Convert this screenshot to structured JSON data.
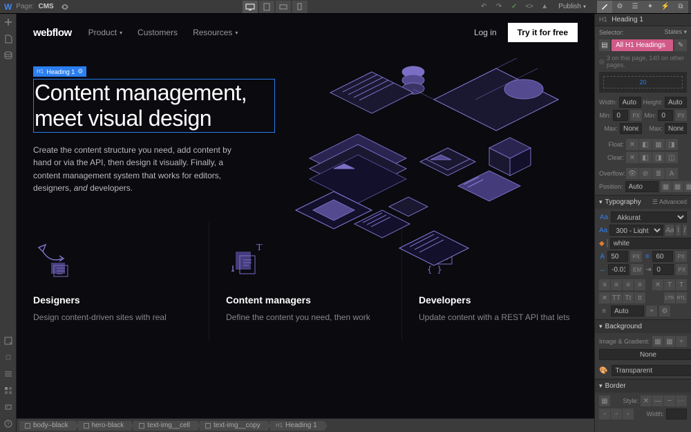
{
  "top_bar": {
    "page_label": "Page:",
    "page_name": "CMS",
    "publish": "Publish"
  },
  "site": {
    "logo": "webflow",
    "nav": {
      "product": "Product",
      "customers": "Customers",
      "resources": "Resources"
    },
    "login": "Log in",
    "cta": "Try it for free"
  },
  "selection_indicator": {
    "tag": "H1",
    "label": "Heading 1"
  },
  "hero": {
    "title": "Content management, meet visual design",
    "subtitle_1": "Create the content structure you need, add content by hand or via the API, then design it visually. Finally, a content management system that works for editors, designers, ",
    "subtitle_and": "and",
    "subtitle_2": " developers."
  },
  "features": {
    "designers": {
      "title": "Designers",
      "body": "Design content-driven sites with real"
    },
    "content_managers": {
      "title": "Content managers",
      "body": "Define the content you need, then work"
    },
    "developers": {
      "title": "Developers",
      "body": "Update content with a REST API that lets"
    }
  },
  "breadcrumbs": [
    "body–black",
    "hero-black",
    "text-img__cell",
    "text-img__copy",
    "Heading 1"
  ],
  "breadcrumb_types": [
    "box",
    "box",
    "box",
    "box",
    "H1"
  ],
  "style_panel": {
    "element_tag": "H1",
    "element_name": "Heading 1",
    "selector_label": "Selector:",
    "states_label": "States",
    "chip": "All H1 Headings",
    "hint": "3 on this page, 140 on other pages.",
    "box_preview": "20",
    "size": {
      "width_label": "Width:",
      "width_val": "Auto",
      "height_label": "Height:",
      "height_val": "Auto",
      "min_label": "Min:",
      "min_val": "0",
      "min_unit": "PX",
      "max_label": "Max:",
      "max_val": "None",
      "float_label": "Float:",
      "clear_label": "Clear:",
      "overflow_label": "Overflow:",
      "position_label": "Position:",
      "position_val": "Auto"
    },
    "typography": {
      "header": "Typography",
      "advanced": "Advanced",
      "font": "Akkurat",
      "weight": "300 - Light",
      "color_name": "white",
      "size_val": "50",
      "size_unit": "PX",
      "line_val": "60",
      "line_unit": "PX",
      "letter_val": "-0.01",
      "letter_unit": "EM",
      "indent_val": "0",
      "indent_unit": "PX",
      "align_auto": "Auto",
      "ltr": "LTR",
      "rtl": "RTL"
    },
    "background": {
      "header": "Background",
      "gradient_label": "Image & Gradient:",
      "gradient_val": "None",
      "color_val": "Transparent"
    },
    "border": {
      "header": "Border",
      "style_label": "Style:",
      "width_label": "Width:"
    }
  }
}
